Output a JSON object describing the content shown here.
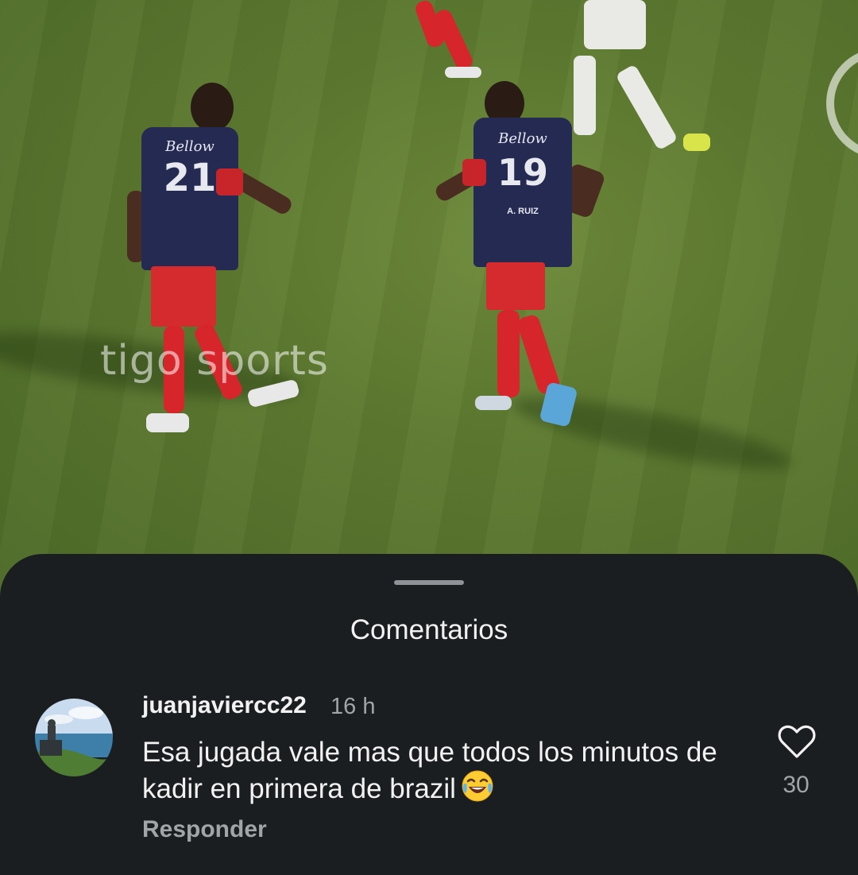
{
  "video": {
    "watermark": "tigo sports",
    "players": {
      "left": {
        "number": "21",
        "sponsor": "Bellow"
      },
      "right": {
        "number": "19",
        "sponsor": "Bellow",
        "surname": "A. RUIZ"
      }
    }
  },
  "sheet": {
    "title": "Comentarios"
  },
  "comments": [
    {
      "username": "juanjaviercc22",
      "time": "16 h",
      "text": "Esa jugada vale mas que todos los minutos de kadir en primera de brazil",
      "emoji": "face-with-tears-of-joy",
      "reply_label": "Responder",
      "likes": "30"
    }
  ],
  "colors": {
    "sheet_background": "#1b1e21",
    "primary_text": "#f2f2f2",
    "secondary_text": "#a2a5a8",
    "grass": "#5d7a30",
    "kit_navy": "#252a52",
    "kit_red": "#d52b2e"
  }
}
